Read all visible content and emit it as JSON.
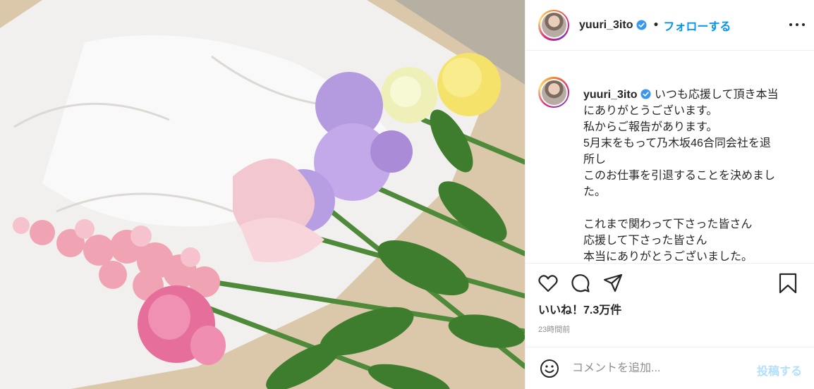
{
  "post": {
    "username": "yuuri_3ito",
    "separator": "•",
    "follow_label": "フォローする",
    "caption_user": "yuuri_3ito",
    "caption_text": "いつも応援して頂き本当\nにありがとうございます。\n私からご報告があります。\n5月末をもって乃木坂46合同会社を退\n所し\nこのお仕事を引退することを決めまし\nた。\n\nこれまで関わって下さった皆さん\n応援して下さった皆さん\n本当にありがとうございました。",
    "likes": "いいね！7.3万件",
    "time": "23時間前"
  },
  "comment": {
    "placeholder": "コメントを追加...",
    "post_label": "投稿する"
  },
  "photo": {
    "description_icon": "flower-bouquet-photo"
  },
  "colors": {
    "accent": "#0095f6",
    "post_disabled": "#b2dffc",
    "muted": "#8e8e8e",
    "verified": "#3897f0"
  }
}
